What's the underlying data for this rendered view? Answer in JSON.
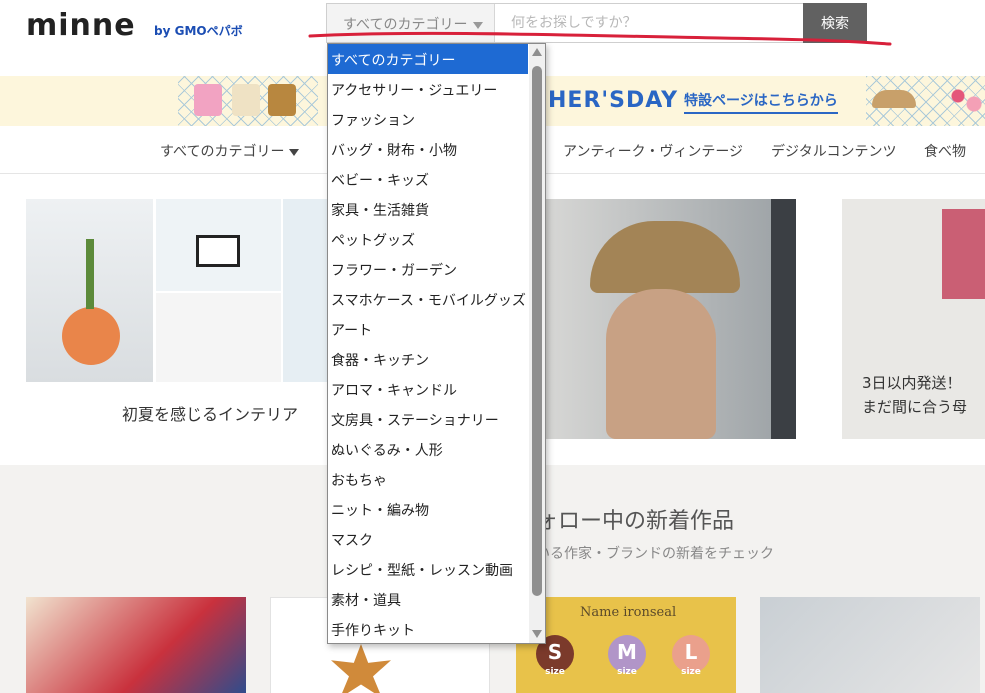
{
  "header": {
    "logo": "minne",
    "logo_by": "by GMOペパボ",
    "search": {
      "category_selected": "すべてのカテゴリー",
      "placeholder": "何をお探しですか？",
      "button_label": "検索"
    }
  },
  "banner": {
    "title": "HER'SDAY",
    "link": "特設ページはこちらから"
  },
  "category_nav": {
    "all_label": "すべてのカテゴリー",
    "items": [
      "アンティーク・ヴィンテージ",
      "デジタルコンテンツ",
      "食べ物"
    ]
  },
  "feature": {
    "interior_caption": "初夏を感じるインテリア",
    "shipping_caption_line1": "3日以内発送！",
    "shipping_caption_line2": "まだ間に合う母"
  },
  "new_works": {
    "title": "ォロー中の新着作品",
    "subtitle": "いる作家・ブランドの新着をチェック",
    "card_text": "Name ironseal",
    "sizes": [
      "S",
      "M",
      "L"
    ],
    "size_sub": "size"
  },
  "dropdown": {
    "options": [
      "すべてのカテゴリー",
      "アクセサリー・ジュエリー",
      "ファッション",
      "バッグ・財布・小物",
      "ベビー・キッズ",
      "家具・生活雑貨",
      "ペットグッズ",
      "フラワー・ガーデン",
      "スマホケース・モバイルグッズ",
      "アート",
      "食器・キッチン",
      "アロマ・キャンドル",
      "文房具・ステーショナリー",
      "ぬいぐるみ・人形",
      "おもちゃ",
      "ニット・編み物",
      "マスク",
      "レシピ・型紙・レッスン動画",
      "素材・道具",
      "手作りキット"
    ],
    "selected_index": 0
  },
  "colors": {
    "accent_blue": "#1e6ad3",
    "banner_blue": "#2a66c4",
    "search_button": "#616161",
    "annotation_red": "#d8203a"
  }
}
